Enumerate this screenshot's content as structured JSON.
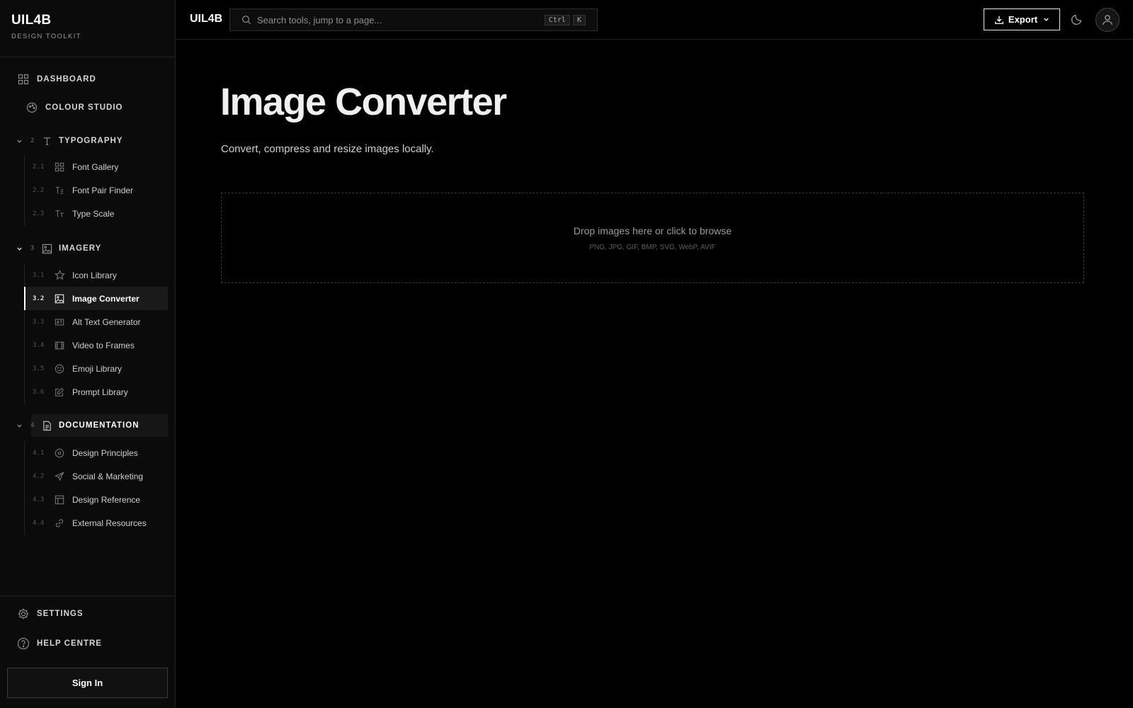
{
  "brand": {
    "title": "UIL4B",
    "subtitle": "DESIGN TOOLKIT"
  },
  "nav_top": [
    {
      "label": "DASHBOARD",
      "icon": "grid-icon"
    },
    {
      "label": "COLOUR STUDIO",
      "icon": "palette-icon"
    }
  ],
  "sections": [
    {
      "number": "2",
      "label": "TYPOGRAPHY",
      "icon": "type-icon",
      "expanded": true,
      "items": [
        {
          "number": "2.1",
          "label": "Font Gallery",
          "icon": "grid-icon"
        },
        {
          "number": "2.2",
          "label": "Font Pair Finder",
          "icon": "text-pair-icon"
        },
        {
          "number": "2.3",
          "label": "Type Scale",
          "icon": "type-scale-icon"
        }
      ]
    },
    {
      "number": "3",
      "label": "IMAGERY",
      "icon": "image-icon",
      "expanded": true,
      "items": [
        {
          "number": "3.1",
          "label": "Icon Library",
          "icon": "star-icon"
        },
        {
          "number": "3.2",
          "label": "Image Converter",
          "icon": "image-icon",
          "active": true
        },
        {
          "number": "3.3",
          "label": "Alt Text Generator",
          "icon": "alt-text-icon"
        },
        {
          "number": "3.4",
          "label": "Video to Frames",
          "icon": "film-icon"
        },
        {
          "number": "3.5",
          "label": "Emoji Library",
          "icon": "smile-icon"
        },
        {
          "number": "3.6",
          "label": "Prompt Library",
          "icon": "edit-icon"
        }
      ]
    },
    {
      "number": "4",
      "label": "DOCUMENTATION",
      "icon": "document-icon",
      "expanded": true,
      "items": [
        {
          "number": "4.1",
          "label": "Design Principles",
          "icon": "compass-icon"
        },
        {
          "number": "4.2",
          "label": "Social & Marketing",
          "icon": "send-icon"
        },
        {
          "number": "4.3",
          "label": "Design Reference",
          "icon": "layout-icon"
        },
        {
          "number": "4.4",
          "label": "External Resources",
          "icon": "link-icon"
        }
      ]
    }
  ],
  "nav_bottom": [
    {
      "label": "SETTINGS",
      "icon": "gear-icon"
    },
    {
      "label": "HELP CENTRE",
      "icon": "help-icon"
    }
  ],
  "sign_in_label": "Sign In",
  "topbar": {
    "title": "UIL4B",
    "search_placeholder": "Search tools, jump to a page...",
    "shortcut_keys": [
      "Ctrl",
      "K"
    ],
    "export_label": "Export"
  },
  "main": {
    "title": "Image Converter",
    "subtitle": "Convert, compress and resize images locally.",
    "dropzone_text": "Drop images here or click to browse",
    "dropzone_formats": "PNG, JPG, GIF, BMP, SVG, WebP, AVIF"
  },
  "colors": {
    "background": "#000000",
    "sidebar": "#0b0b0b",
    "active_item": "#1a1a1a",
    "accent": "#ffffff"
  }
}
